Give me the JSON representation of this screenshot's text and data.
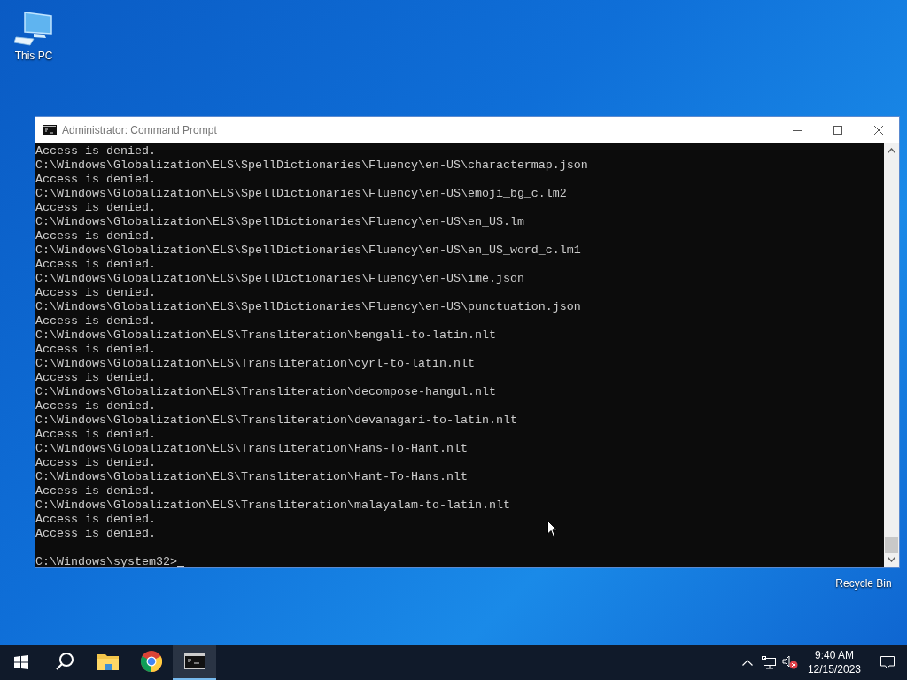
{
  "desktop_icons": [
    {
      "label": "This PC",
      "kind": "computer"
    },
    {
      "label": "Recycle Bin",
      "kind": "bin"
    }
  ],
  "window": {
    "title": "Administrator: Command Prompt",
    "lines": [
      "Access is denied.",
      "C:\\Windows\\Globalization\\ELS\\SpellDictionaries\\Fluency\\en-US\\charactermap.json",
      "Access is denied.",
      "C:\\Windows\\Globalization\\ELS\\SpellDictionaries\\Fluency\\en-US\\emoji_bg_c.lm2",
      "Access is denied.",
      "C:\\Windows\\Globalization\\ELS\\SpellDictionaries\\Fluency\\en-US\\en_US.lm",
      "Access is denied.",
      "C:\\Windows\\Globalization\\ELS\\SpellDictionaries\\Fluency\\en-US\\en_US_word_c.lm1",
      "Access is denied.",
      "C:\\Windows\\Globalization\\ELS\\SpellDictionaries\\Fluency\\en-US\\ime.json",
      "Access is denied.",
      "C:\\Windows\\Globalization\\ELS\\SpellDictionaries\\Fluency\\en-US\\punctuation.json",
      "Access is denied.",
      "C:\\Windows\\Globalization\\ELS\\Transliteration\\bengali-to-latin.nlt",
      "Access is denied.",
      "C:\\Windows\\Globalization\\ELS\\Transliteration\\cyrl-to-latin.nlt",
      "Access is denied.",
      "C:\\Windows\\Globalization\\ELS\\Transliteration\\decompose-hangul.nlt",
      "Access is denied.",
      "C:\\Windows\\Globalization\\ELS\\Transliteration\\devanagari-to-latin.nlt",
      "Access is denied.",
      "C:\\Windows\\Globalization\\ELS\\Transliteration\\Hans-To-Hant.nlt",
      "Access is denied.",
      "C:\\Windows\\Globalization\\ELS\\Transliteration\\Hant-To-Hans.nlt",
      "Access is denied.",
      "C:\\Windows\\Globalization\\ELS\\Transliteration\\malayalam-to-latin.nlt",
      "Access is denied.",
      "Access is denied."
    ],
    "prompt": "C:\\Windows\\system32>"
  },
  "taskbar": {
    "apps": [
      {
        "kind": "search",
        "selected": false
      },
      {
        "kind": "explorer",
        "selected": false
      },
      {
        "kind": "chrome",
        "selected": false
      },
      {
        "kind": "console",
        "selected": true
      }
    ],
    "time": "9:40 AM",
    "date": "12/15/2023"
  }
}
